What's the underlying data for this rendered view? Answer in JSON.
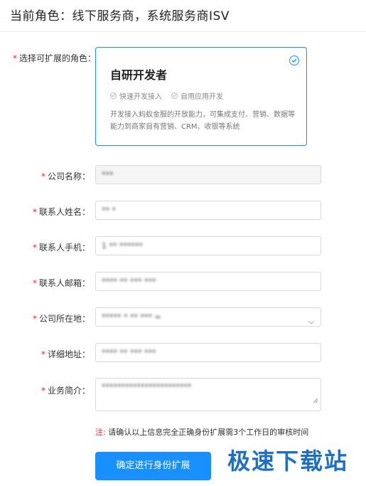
{
  "header": {
    "title": "当前角色：线下服务商，系统服务商ISV"
  },
  "role_section": {
    "label": "选择可扩展的角色：",
    "card": {
      "title": "自研开发者",
      "features": [
        "快速开发接入",
        "自用应用开发"
      ],
      "description": "开发接入蚂蚁金服的开放能力，可集成支付、营销、数据等能力到商家自有营销、CRM、收银等系统",
      "selected": true
    }
  },
  "form": {
    "company_name": {
      "label": "公司名称：",
      "value": "*** "
    },
    "contact_name": {
      "label": "联系人姓名：",
      "value": "** *"
    },
    "contact_phone": {
      "label": "联系人手机：",
      "value": "1 ** ****** "
    },
    "contact_email": {
      "label": "联系人邮箱：",
      "value": "**** ** *** ***"
    },
    "company_location": {
      "label": "公司所在地：",
      "value": "***** * ** *** ="
    },
    "address_detail": {
      "label": "详细地址：",
      "value": "**** ** *** ***"
    },
    "business_intro": {
      "label": "业务简介：",
      "value": "***********************"
    }
  },
  "note": {
    "prefix": "注:",
    "text": " 请确认以上信息完全正确身份扩展需3个工作日的审核时间"
  },
  "submit": {
    "label": "确定进行身份扩展"
  },
  "watermark": {
    "text": "极速下载站"
  },
  "colors": {
    "primary": "#1890ff",
    "required": "#f5222d"
  }
}
